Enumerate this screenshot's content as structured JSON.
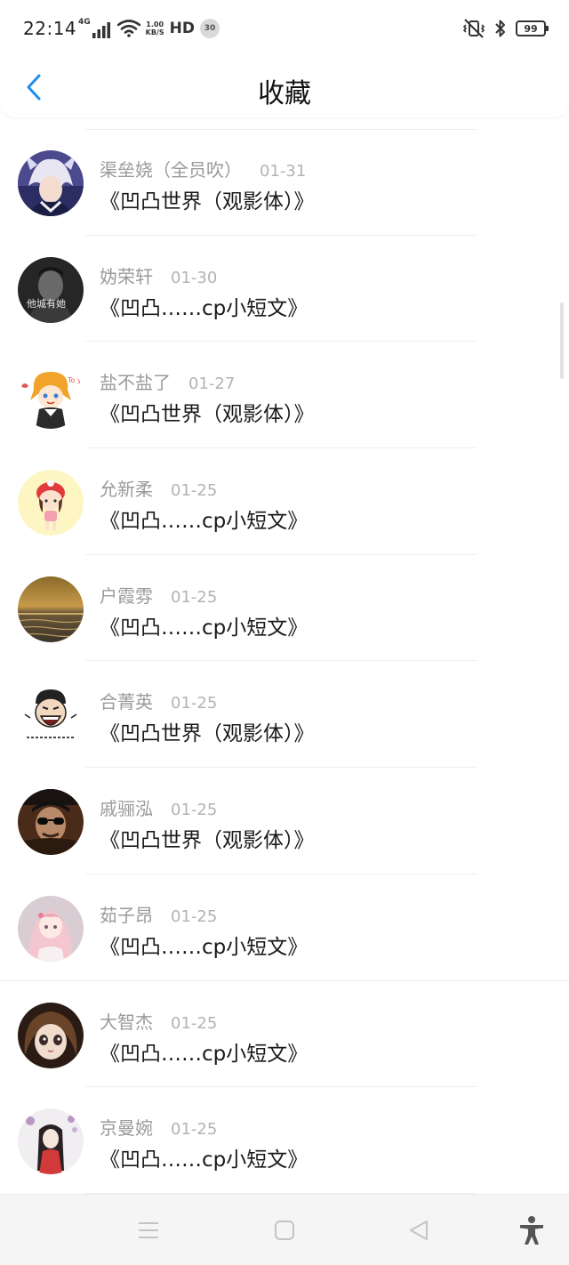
{
  "status_bar": {
    "time": "22:14",
    "network": "4G",
    "speed_value": "1.00",
    "speed_unit": "KB/S",
    "hd": "HD",
    "badge": "30",
    "battery": "99"
  },
  "header": {
    "title": "收藏",
    "back_icon": "chevron-left-icon",
    "accent_color": "#1e8ff0"
  },
  "favorites": [
    {
      "author": "渠垒娆（全员吹）",
      "date": "01-31",
      "title": "《凹凸世界（观影体）》",
      "avatar": "anime-boy-white-hair"
    },
    {
      "author": "妫荣轩",
      "date": "01-30",
      "title": "《凹凸……cp小短文》",
      "avatar": "dark-photo-boy",
      "avatar_caption": "他城有她"
    },
    {
      "author": "盐不盐了",
      "date": "01-27",
      "title": "《凹凸世界（观影体）》",
      "avatar": "chibi-orange-hair",
      "avatar_caption": "To you"
    },
    {
      "author": "允新柔",
      "date": "01-25",
      "title": "《凹凸……cp小短文》",
      "avatar": "cartoon-girl-red-hat"
    },
    {
      "author": "户霞雰",
      "date": "01-25",
      "title": "《凹凸……cp小短文》",
      "avatar": "sea-sunset"
    },
    {
      "author": "合菁英",
      "date": "01-25",
      "title": "《凹凸世界（观影体）》",
      "avatar": "laughing-cartoon"
    },
    {
      "author": "戚骊泓",
      "date": "01-25",
      "title": "《凹凸世界（观影体）》",
      "avatar": "man-sunglasses"
    },
    {
      "author": "茹子昂",
      "date": "01-25",
      "title": "《凹凸……cp小短文》",
      "avatar": "anime-girl-pink"
    },
    {
      "author": "大智杰",
      "date": "01-25",
      "title": "《凹凸……cp小短文》",
      "avatar": "doll-face"
    },
    {
      "author": "京曼婉",
      "date": "01-25",
      "title": "《凹凸……cp小短文》",
      "avatar": "girl-red-dress"
    }
  ],
  "nav_bar": {
    "menu_icon": "menu-icon",
    "home_icon": "square-home-icon",
    "back_icon": "triangle-back-icon",
    "accessibility_icon": "accessibility-icon"
  }
}
